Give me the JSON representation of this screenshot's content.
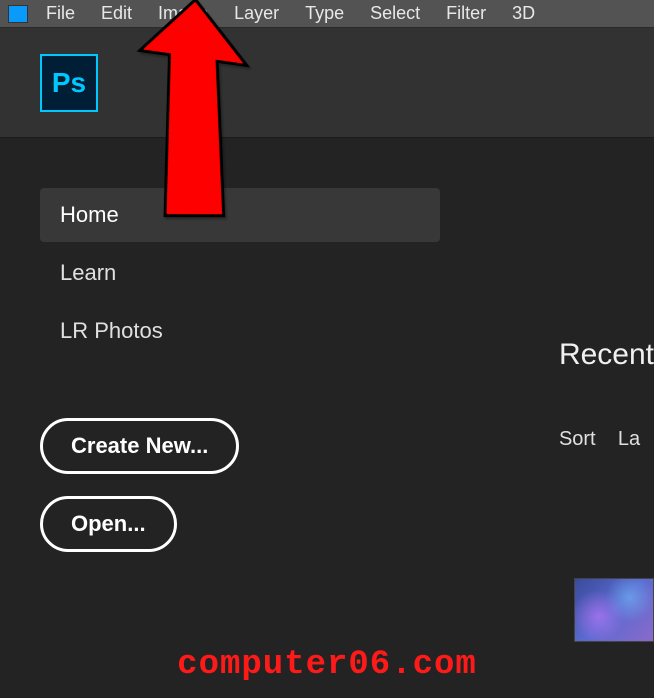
{
  "menubar": {
    "items": [
      "File",
      "Edit",
      "Image",
      "Layer",
      "Type",
      "Select",
      "Filter",
      "3D"
    ]
  },
  "logo": {
    "text": "Ps"
  },
  "sidebar": {
    "nav": [
      {
        "label": "Home",
        "active": true
      },
      {
        "label": "Learn",
        "active": false
      },
      {
        "label": "LR Photos",
        "active": false
      }
    ],
    "buttons": {
      "create": "Create New...",
      "open": "Open..."
    }
  },
  "rightPanel": {
    "heading": "Recent",
    "sortLabel": "Sort",
    "sortValue": "La"
  },
  "watermark": "computer06.com"
}
